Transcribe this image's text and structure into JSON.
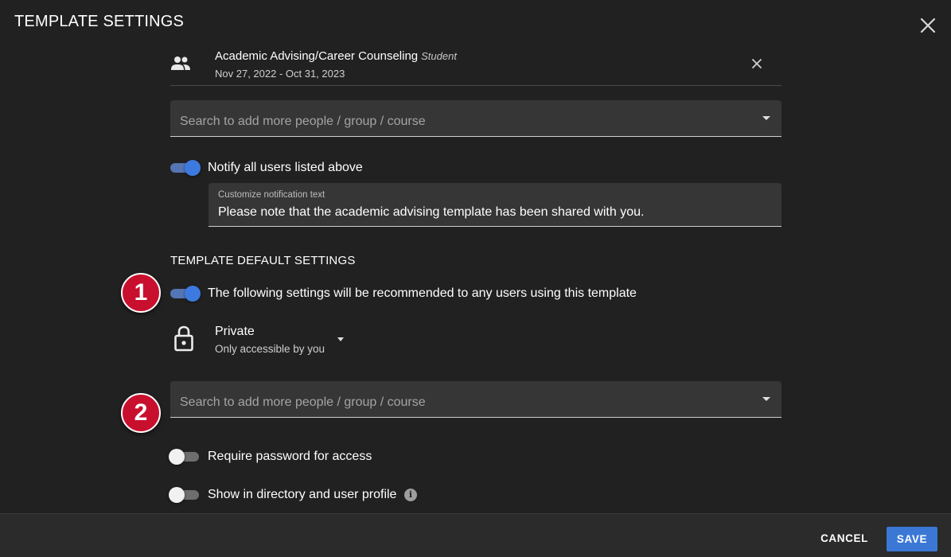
{
  "dialog": {
    "title": "TEMPLATE SETTINGS",
    "close_icon": "close-icon"
  },
  "shared_entry": {
    "icon": "people-icon",
    "name": "Academic Advising/Career Counseling",
    "role": "Student",
    "dates": "Nov 27, 2022 - Oct 31, 2023",
    "remove_icon": "close-icon"
  },
  "share_search": {
    "placeholder": "Search to add more people / group / course"
  },
  "notify": {
    "toggle_on": true,
    "label": "Notify all users listed above",
    "text_field_label": "Customize notification text",
    "text_field_value": "Please note that the academic advising template has been shared with you."
  },
  "defaults": {
    "heading": "TEMPLATE DEFAULT SETTINGS",
    "recommend_toggle_on": true,
    "recommend_label": "The following settings will be recommended to any users using this template",
    "privacy_title": "Private",
    "privacy_subtitle": "Only accessible by you",
    "privacy_icon": "lock-icon",
    "search_placeholder": "Search to add more people / group / course",
    "password_toggle_on": false,
    "password_label": "Require password for access",
    "directory_toggle_on": false,
    "directory_label": "Show in directory and user profile",
    "info_icon": "info-icon"
  },
  "markers": {
    "one": "1",
    "two": "2"
  },
  "footer": {
    "cancel_label": "CANCEL",
    "save_label": "SAVE"
  },
  "colors": {
    "background": "#212121",
    "accent": "#3b78d6",
    "marker": "#c8102e"
  }
}
